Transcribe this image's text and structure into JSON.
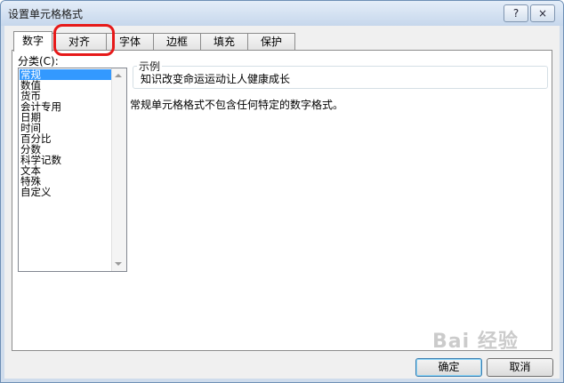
{
  "window": {
    "title": "设置单元格格式",
    "help_label": "?",
    "close_label": "×"
  },
  "tabs": [
    {
      "label": "数字"
    },
    {
      "label": "对齐"
    },
    {
      "label": "字体"
    },
    {
      "label": "边框"
    },
    {
      "label": "填充"
    },
    {
      "label": "保护"
    }
  ],
  "category": {
    "label": "分类(C):",
    "items": [
      "常规",
      "数值",
      "货币",
      "会计专用",
      "日期",
      "时间",
      "百分比",
      "分数",
      "科学记数",
      "文本",
      "特殊",
      "自定义"
    ]
  },
  "sample": {
    "legend": "示例",
    "text": "知识改变命运运动让人健康成长"
  },
  "description": "常规单元格格式不包含任何特定的数字格式。",
  "buttons": {
    "ok": "确定",
    "cancel": "取消"
  },
  "watermark": "Bai 经验",
  "annotation_color": "#e61919"
}
